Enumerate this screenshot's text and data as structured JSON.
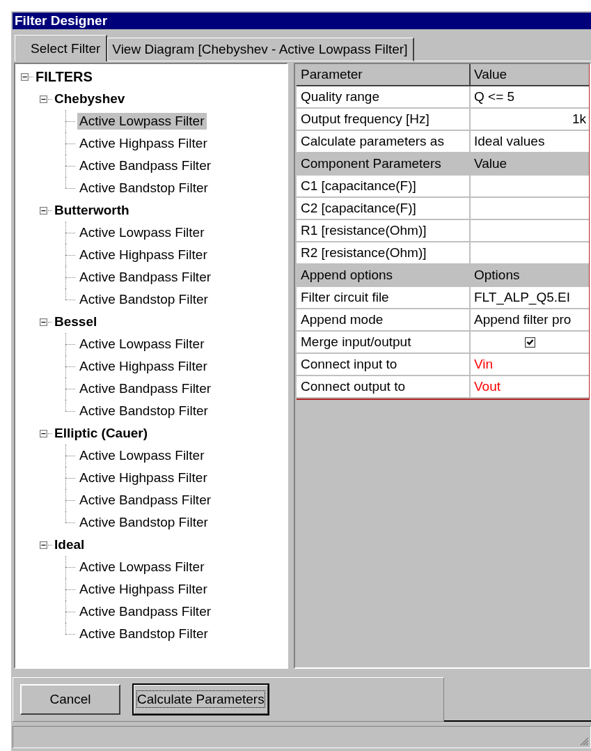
{
  "window": {
    "title": "Filter Designer"
  },
  "tabs": [
    {
      "label": "Select Filter",
      "selected": true
    },
    {
      "label": "View Diagram [Chebyshev - Active Lowpass Filter]",
      "selected": false
    }
  ],
  "tree": {
    "label": "FILTERS",
    "expanded": true,
    "children": [
      {
        "label": "Chebyshev",
        "expanded": true,
        "children": [
          {
            "label": "Active Lowpass Filter",
            "selected": true
          },
          {
            "label": "Active Highpass Filter",
            "selected": false
          },
          {
            "label": "Active Bandpass Filter",
            "selected": false
          },
          {
            "label": "Active Bandstop Filter",
            "selected": false
          }
        ]
      },
      {
        "label": "Butterworth",
        "expanded": true,
        "children": [
          {
            "label": "Active Lowpass Filter",
            "selected": false
          },
          {
            "label": "Active Highpass Filter",
            "selected": false
          },
          {
            "label": "Active Bandpass Filter",
            "selected": false
          },
          {
            "label": "Active Bandstop Filter",
            "selected": false
          }
        ]
      },
      {
        "label": "Bessel",
        "expanded": true,
        "children": [
          {
            "label": "Active Lowpass Filter",
            "selected": false
          },
          {
            "label": "Active Highpass Filter",
            "selected": false
          },
          {
            "label": "Active Bandpass Filter",
            "selected": false
          },
          {
            "label": "Active Bandstop Filter",
            "selected": false
          }
        ]
      },
      {
        "label": "Elliptic (Cauer)",
        "expanded": true,
        "children": [
          {
            "label": "Active Lowpass Filter",
            "selected": false
          },
          {
            "label": "Active Highpass Filter",
            "selected": false
          },
          {
            "label": "Active Bandpass Filter",
            "selected": false
          },
          {
            "label": "Active Bandstop Filter",
            "selected": false
          }
        ]
      },
      {
        "label": "Ideal",
        "expanded": true,
        "children": [
          {
            "label": "Active Lowpass Filter",
            "selected": false
          },
          {
            "label": "Active Highpass Filter",
            "selected": false
          },
          {
            "label": "Active Bandpass Filter",
            "selected": false
          },
          {
            "label": "Active Bandstop Filter",
            "selected": false
          }
        ]
      }
    ]
  },
  "grid": {
    "rows": [
      {
        "kind": "header",
        "name": "Parameter",
        "value": "Value"
      },
      {
        "kind": "text",
        "name": "Quality range",
        "value": "Q <= 5"
      },
      {
        "kind": "number",
        "name": "Output frequency [Hz]",
        "value": "1k"
      },
      {
        "kind": "text",
        "name": "Calculate parameters as",
        "value": "Ideal values"
      },
      {
        "kind": "section",
        "name": "Component Parameters",
        "value": "Value"
      },
      {
        "kind": "empty",
        "name": "C1 [capacitance(F)]"
      },
      {
        "kind": "empty",
        "name": "C2 [capacitance(F)]"
      },
      {
        "kind": "empty",
        "name": "R1 [resistance(Ohm)]"
      },
      {
        "kind": "empty",
        "name": "R2 [resistance(Ohm)]"
      },
      {
        "kind": "section",
        "name": "Append options",
        "value": "Options"
      },
      {
        "kind": "text",
        "name": "Filter circuit file",
        "value": "FLT_ALP_Q5.EI"
      },
      {
        "kind": "text",
        "name": "Append mode",
        "value": "Append filter pro"
      },
      {
        "kind": "check",
        "name": "Merge input/output",
        "checked": true
      },
      {
        "kind": "text",
        "name": "Connect input to",
        "value": "Vin",
        "color": "#ff0000"
      },
      {
        "kind": "text",
        "name": "Connect output to",
        "value": "Vout",
        "color": "#ff0000"
      }
    ]
  },
  "buttons": [
    {
      "label": "Cancel",
      "default": false
    },
    {
      "label": "Calculate Parameters",
      "default": true
    }
  ]
}
